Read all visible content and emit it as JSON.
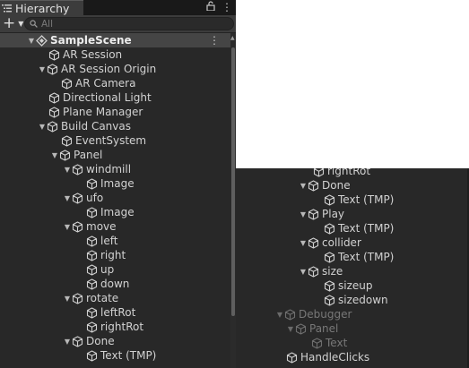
{
  "window": {
    "tab_title": "Hierarchy",
    "lock_glyph": "🔓",
    "menu_glyph": "⋮"
  },
  "toolbar": {
    "add_glyph": "+",
    "add_caret": "▼",
    "search_placeholder": "All"
  },
  "tree": {
    "scene_label": "SampleScene",
    "scene_menu": "⋮",
    "items": [
      {
        "label": "AR Session"
      },
      {
        "label": "AR Session Origin"
      },
      {
        "label": "AR Camera"
      },
      {
        "label": "Directional Light"
      },
      {
        "label": "Plane Manager"
      },
      {
        "label": "Build Canvas"
      },
      {
        "label": "EventSystem"
      },
      {
        "label": "Panel"
      },
      {
        "label": "windmill"
      },
      {
        "label": "Image"
      },
      {
        "label": "ufo"
      },
      {
        "label": "Image"
      },
      {
        "label": "move"
      },
      {
        "label": "left"
      },
      {
        "label": "right"
      },
      {
        "label": "up"
      },
      {
        "label": "down"
      },
      {
        "label": "rotate"
      },
      {
        "label": "leftRot"
      },
      {
        "label": "rightRot"
      },
      {
        "label": "Done"
      },
      {
        "label": "Text (TMP)"
      }
    ]
  },
  "right_tree": {
    "items": [
      {
        "label": "rightRot"
      },
      {
        "label": "Done"
      },
      {
        "label": "Text (TMP)"
      },
      {
        "label": "Play"
      },
      {
        "label": "Text (TMP)"
      },
      {
        "label": "collider"
      },
      {
        "label": "Text (TMP)"
      },
      {
        "label": "size"
      },
      {
        "label": "sizeup"
      },
      {
        "label": "sizedown"
      },
      {
        "label": "Debugger"
      },
      {
        "label": "Panel"
      },
      {
        "label": "Text"
      },
      {
        "label": "HandleClicks"
      }
    ]
  },
  "colors": {
    "panel_bg": "#282828",
    "header_bg": "#3c3c3c",
    "selected_row_bg": "#454545",
    "text": "#d2d2d2",
    "muted_text": "#787878"
  }
}
